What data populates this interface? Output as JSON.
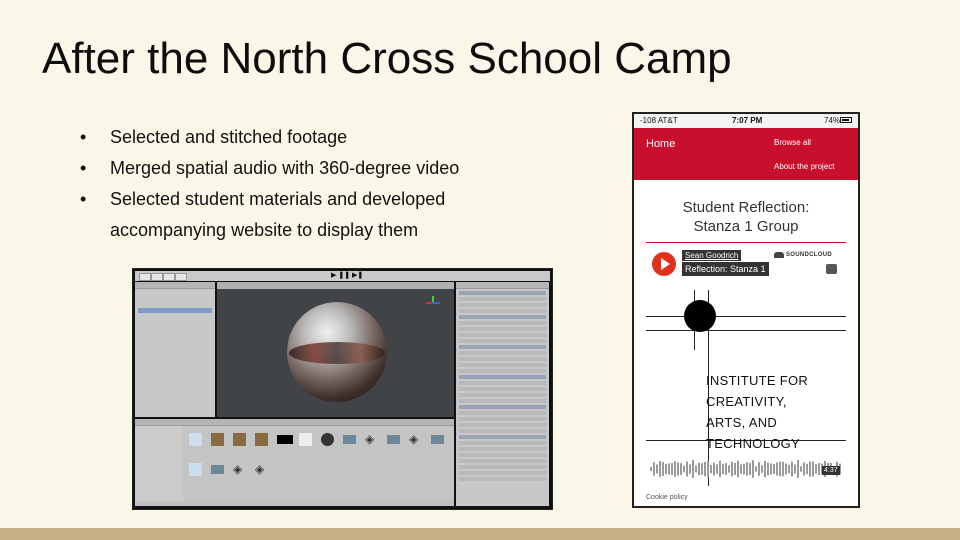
{
  "slide": {
    "title": "After the North Cross School Camp",
    "bullets": [
      "Selected and stitched footage",
      "Merged spatial audio with 360-degree video",
      "Selected student materials and developed accompanying website to display them"
    ]
  },
  "phone": {
    "status": {
      "carrier": "-108 AT&T",
      "time": "7:07 PM",
      "battery": "74%"
    },
    "nav": {
      "home": "Home",
      "browse": "Browse all",
      "about": "About the project"
    },
    "page_title_line1": "Student Reflection:",
    "page_title_line2": "Stanza 1 Group",
    "soundcloud": {
      "user": "Sean Goodrich",
      "track": "Reflection: Stanza 1",
      "logo": "SOUNDCLOUD",
      "duration": "4:37"
    },
    "artwork_text": [
      "INSTITUTE FOR",
      "CREATIVITY,",
      "ARTS, AND",
      "TECHNOLOGY"
    ],
    "cookie": "Cookie policy"
  },
  "colors": {
    "background": "#fbf7e8",
    "accent_red": "#c8102e",
    "footer_bar": "#c8b085"
  }
}
